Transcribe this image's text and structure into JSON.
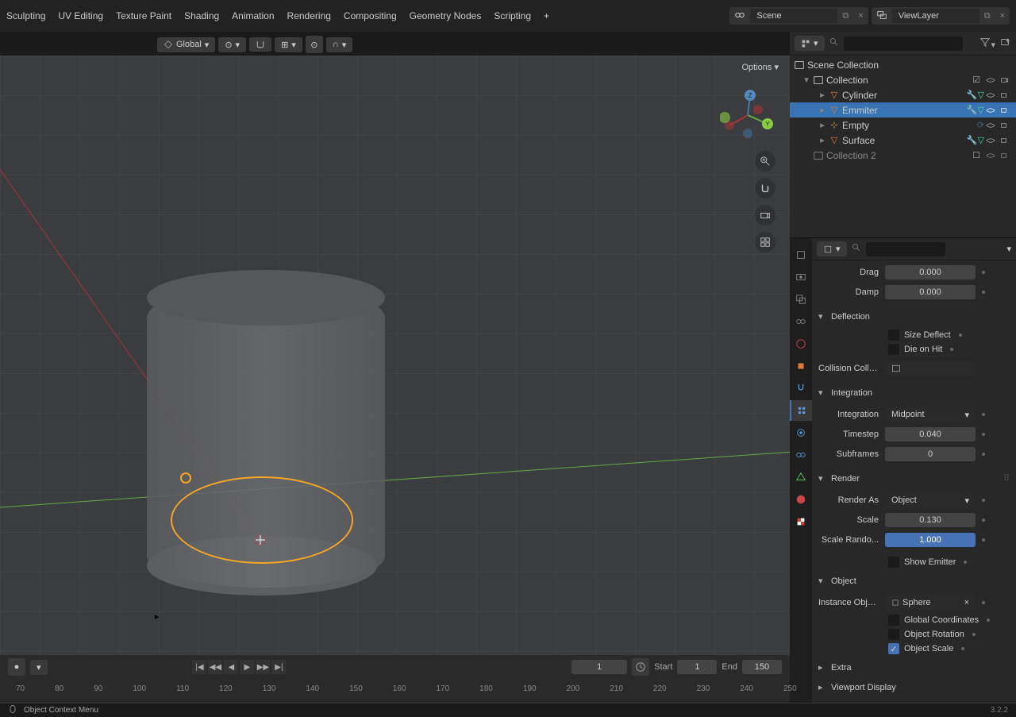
{
  "header": {
    "tabs": [
      "Sculpting",
      "UV Editing",
      "Texture Paint",
      "Shading",
      "Animation",
      "Rendering",
      "Compositing",
      "Geometry Nodes",
      "Scripting"
    ],
    "scene_label": "Scene",
    "viewlayer_label": "ViewLayer"
  },
  "toolbar": {
    "orientation": "Global",
    "options": "Options"
  },
  "outliner": {
    "scene": "Scene Collection",
    "collection": "Collection",
    "items": [
      {
        "name": "Cylinder",
        "type": "mesh"
      },
      {
        "name": "Emmiter",
        "type": "mesh",
        "selected": true
      },
      {
        "name": "Empty",
        "type": "empty"
      },
      {
        "name": "Surface",
        "type": "mesh"
      }
    ],
    "collection2": "Collection 2"
  },
  "properties": {
    "drag_label": "Drag",
    "drag_value": "0.000",
    "damp_label": "Damp",
    "damp_value": "0.000",
    "deflection": "Deflection",
    "size_deflect": "Size Deflect",
    "die_on_hit": "Die on Hit",
    "collision_colle": "Collision Colle...",
    "integration_panel": "Integration",
    "integration_label": "Integration",
    "integration_value": "Midpoint",
    "timestep_label": "Timestep",
    "timestep_value": "0.040",
    "subframes_label": "Subframes",
    "subframes_value": "0",
    "render_panel": "Render",
    "render_as_label": "Render As",
    "render_as_value": "Object",
    "scale_label": "Scale",
    "scale_value": "0.130",
    "scale_random_label": "Scale Rando...",
    "scale_random_value": "1.000",
    "show_emitter": "Show Emitter",
    "object_panel": "Object",
    "instance_object_label": "Instance Object",
    "instance_object_value": "Sphere",
    "global_coords": "Global Coordinates",
    "object_rotation": "Object Rotation",
    "object_scale": "Object Scale",
    "extra_panel": "Extra",
    "viewport_display_panel": "Viewport Display"
  },
  "timeline": {
    "current_frame": "1",
    "start_label": "Start",
    "start_value": "1",
    "end_label": "End",
    "end_value": "150",
    "ticks": [
      "70",
      "80",
      "90",
      "100",
      "110",
      "120",
      "130",
      "140",
      "150",
      "160",
      "170",
      "180",
      "190",
      "200",
      "210",
      "220",
      "230",
      "240",
      "250"
    ]
  },
  "status": {
    "context_menu": "Object Context Menu",
    "version": "3.2.2"
  }
}
